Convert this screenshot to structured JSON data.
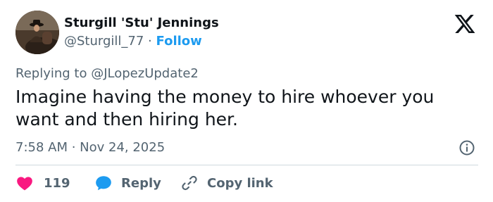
{
  "author": {
    "display_name": "Sturgill 'Stu' Jennings",
    "handle": "@Sturgill_77",
    "separator": "·",
    "follow_label": "Follow"
  },
  "reply_context": {
    "prefix": "Replying to",
    "mention": "@JLopezUpdate2"
  },
  "tweet": {
    "text": "Imagine having the money to hire whoever you want and then hiring her.",
    "timestamp": "7:58 AM · Nov 24, 2025"
  },
  "actions": {
    "like_count": "119",
    "reply_label": "Reply",
    "copy_link_label": "Copy link"
  },
  "icons": {
    "logo": "x-logo-icon",
    "info": "info-icon",
    "like": "heart-icon",
    "reply": "chat-bubble-icon",
    "copy": "link-icon"
  },
  "colors": {
    "accent": "#1d9bf0",
    "like": "#f91880",
    "text": "#0f1419",
    "secondary": "#536471",
    "divider": "#cfd9de"
  }
}
